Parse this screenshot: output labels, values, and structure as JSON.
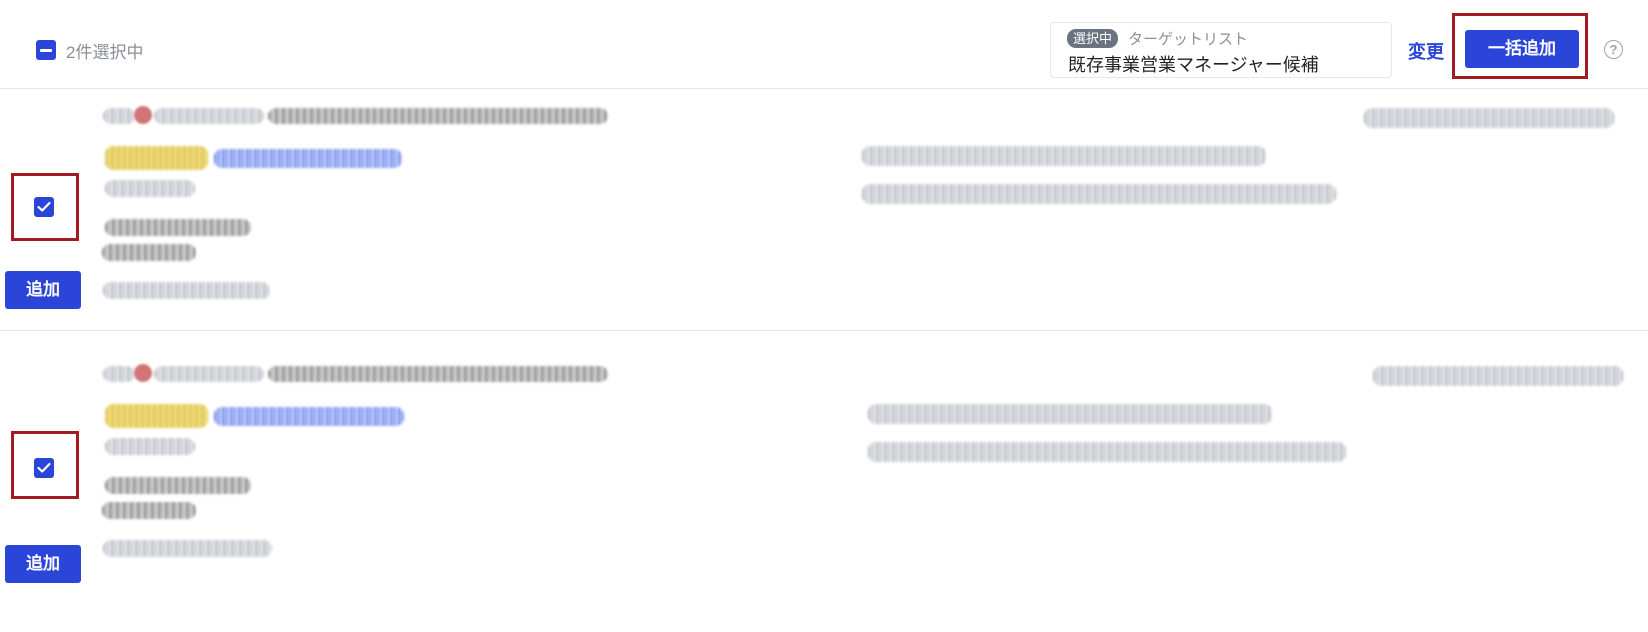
{
  "header": {
    "selection_count": "2件選択中",
    "target_badge": "選択中",
    "target_label": "ターゲットリスト",
    "target_name": "既存事業営業マネージャー候補",
    "change_label": "変更",
    "bulk_add_label": "一括追加",
    "help_symbol": "?"
  },
  "rows": [
    {
      "checked": true,
      "add_label": "追加"
    },
    {
      "checked": true,
      "add_label": "追加"
    }
  ],
  "colors": {
    "accent": "#2b45d8",
    "highlight_frame": "#a01c22",
    "muted_text": "#8a8f99",
    "badge": "#6b7280"
  }
}
